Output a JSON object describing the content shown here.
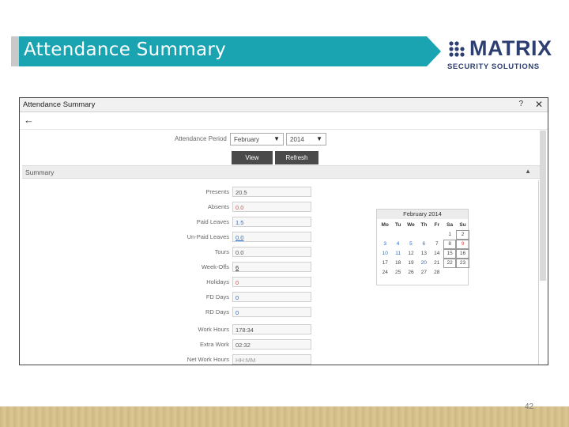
{
  "slide": {
    "title": "Attendance Summary",
    "page_number": "42",
    "colors": {
      "banner": "#1aa3b0",
      "logo": "#2d3e70",
      "footer": "#d8c38e"
    }
  },
  "logo": {
    "word": "MATRIX",
    "tagline": "SECURITY SOLUTIONS"
  },
  "window": {
    "title": "Attendance Summary",
    "help_icon": "?",
    "close_icon": "✕",
    "back_icon": "←",
    "period_label": "Attendance Period",
    "month_value": "February",
    "year_value": "2014",
    "view_label": "View",
    "refresh_label": "Refresh",
    "section_label": "Summary",
    "collapse_icon": "▲"
  },
  "fields": [
    {
      "label": "Presents",
      "value": "20.5"
    },
    {
      "label": "Absents",
      "value": "0.0"
    },
    {
      "label": "Paid Leaves",
      "value": "1.5"
    },
    {
      "label": "Un-Paid Leaves",
      "value": "0.0"
    },
    {
      "label": "Tours",
      "value": "0.0"
    },
    {
      "label": "Week-Offs",
      "value": "6"
    },
    {
      "label": "Holidays",
      "value": "0"
    },
    {
      "label": "FD Days",
      "value": "0"
    },
    {
      "label": "RD Days",
      "value": "0"
    },
    {
      "label": "Work Hours",
      "value": "178:34"
    },
    {
      "label": "Extra Work",
      "value": "02:32"
    },
    {
      "label": "Net Work Hours",
      "value": "HH:MM"
    }
  ],
  "calendar": {
    "title": "February 2014",
    "dow": [
      "Mo",
      "Tu",
      "We",
      "Th",
      "Fr",
      "Sa",
      "Su"
    ],
    "rows": [
      [
        "",
        "",
        "",
        "",
        "",
        "1",
        "2"
      ],
      [
        "3",
        "4",
        "5",
        "6",
        "7",
        "8",
        "9"
      ],
      [
        "10",
        "11",
        "12",
        "13",
        "14",
        "15",
        "16"
      ],
      [
        "17",
        "18",
        "19",
        "20",
        "21",
        "22",
        "23"
      ],
      [
        "24",
        "25",
        "26",
        "27",
        "28",
        "",
        ""
      ]
    ]
  }
}
